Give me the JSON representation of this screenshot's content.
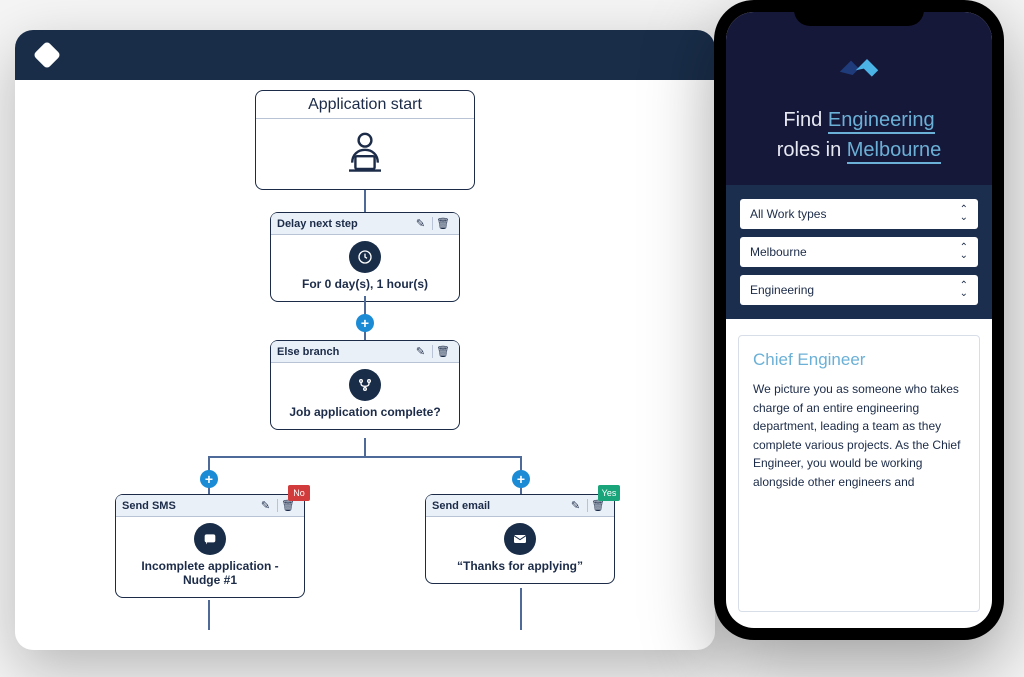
{
  "desktop": {
    "start": {
      "title": "Application start"
    },
    "nodes": {
      "delay": {
        "header": "Delay next step",
        "body": "For 0 day(s), 1 hour(s)"
      },
      "branch": {
        "header": "Else branch",
        "body": "Job application complete?"
      },
      "sms": {
        "header": "Send SMS",
        "badge": "No",
        "body": "Incomplete application - Nudge #1"
      },
      "email": {
        "header": "Send email",
        "badge": "Yes",
        "body": "“Thanks for applying”"
      }
    }
  },
  "phone": {
    "hero_prefix": "Find ",
    "hero_highlight1": "Engineering",
    "hero_mid": " roles in ",
    "hero_highlight2": "Melbourne",
    "filters": {
      "worktype": "All Work types",
      "location": "Melbourne",
      "category": "Engineering"
    },
    "card": {
      "title": "Chief Engineer",
      "body": "We picture you as someone who takes charge of an entire engineering department, leading a team as they complete various projects. As the Chief Engineer, you would be working alongside other engineers and"
    }
  }
}
